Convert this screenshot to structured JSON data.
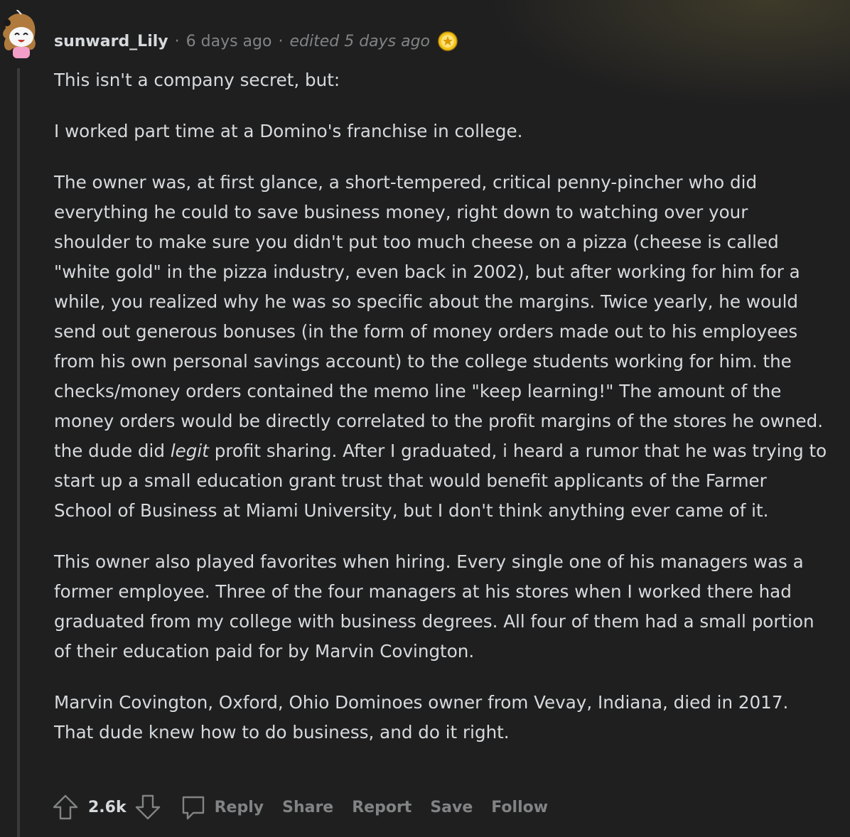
{
  "comment": {
    "username": "sunward_Lily",
    "posted": "6 days ago",
    "edited": "edited 5 days ago",
    "separator": "·",
    "award_icon": "award-icon",
    "avatar_icon": "snoo-avatar-icon",
    "paragraphs": [
      "This isn't a company secret, but:",
      "I worked part time at a Domino's franchise in college.",
      "The owner was, at first glance, a short-tempered, critical penny-pincher who did everything he could to save business money, right down to watching over your shoulder to make sure you didn't put too much cheese on a pizza (cheese is called \"white gold\" in the pizza industry, even back in 2002), but after working for him for a while, you realized why he was so specific about the margins. Twice yearly, he would send out generous bonuses (in the form of money orders made out to his employees from his own personal savings account) to the college students working for him. the checks/money orders contained the memo line \"keep learning!\" The amount of the money orders would be directly correlated to the profit margins of the stores he owned. the dude did",
      "This owner also played favorites when hiring. Every single one of his managers was a former employee. Three of the four managers at his stores when I worked there had graduated from my college with business degrees. All four of them had a small portion of their education paid for by Marvin Covington.",
      "Marvin Covington, Oxford, Ohio Dominoes owner from Vevay, Indiana, died in 2017. That dude knew how to do business, and do it right."
    ],
    "p3_italic": "legit",
    "p3_tail": " profit sharing. After I graduated, i heard a rumor that he was trying to start up a small education grant trust that would benefit applicants of the Farmer School of Business at Miami University, but I don't think anything ever came of it."
  },
  "actions": {
    "score": "2.6k",
    "reply": "Reply",
    "share": "Share",
    "report": "Report",
    "save": "Save",
    "follow": "Follow",
    "upvote_icon": "upvote-arrow-icon",
    "downvote_icon": "downvote-arrow-icon",
    "reply_icon": "comment-bubble-icon"
  },
  "colors": {
    "background": "#1f1f20",
    "text": "#d7dadc",
    "muted": "#818384",
    "award_gold": "#f5c518"
  }
}
